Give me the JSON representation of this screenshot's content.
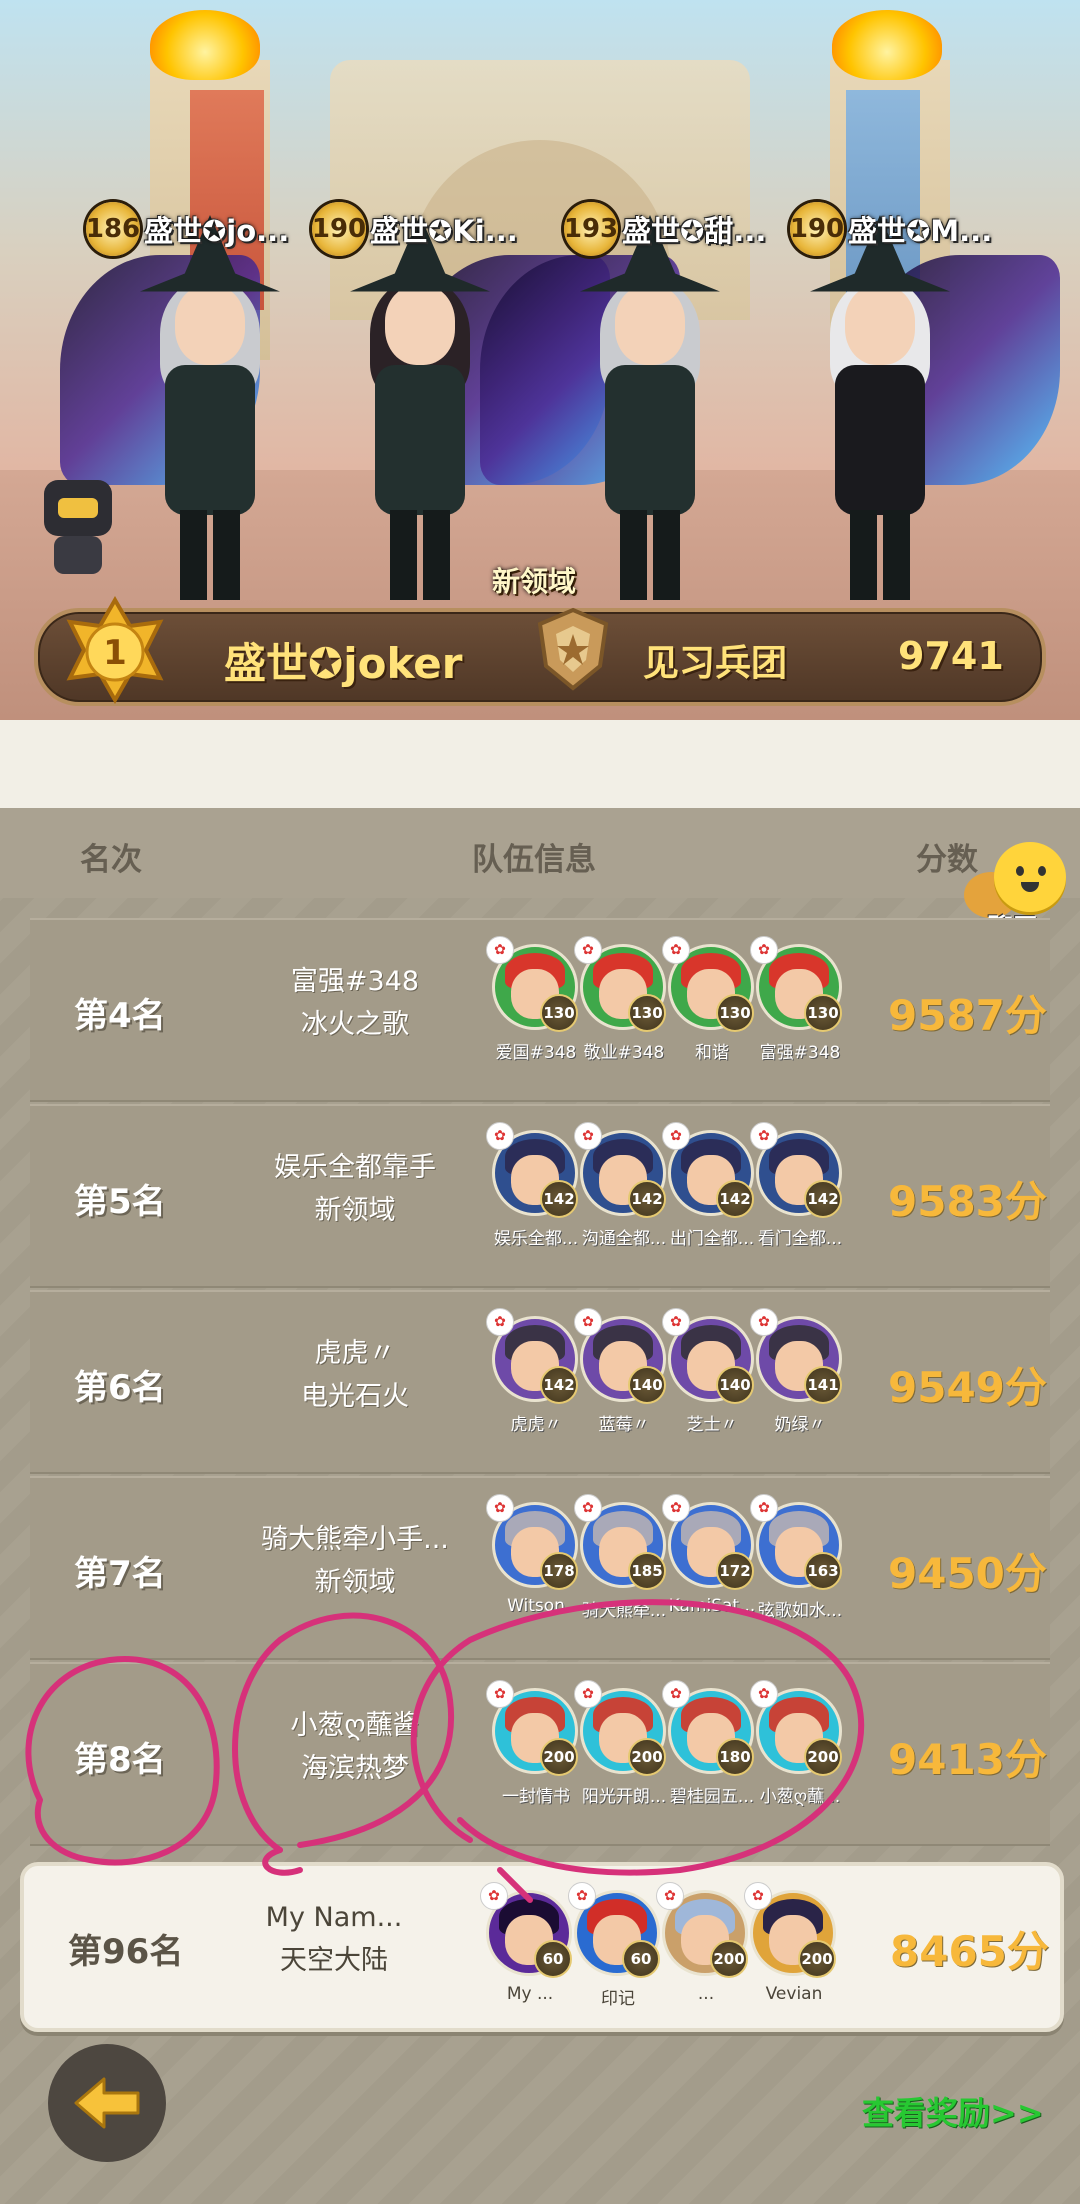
{
  "banner": {
    "players": [
      {
        "level": "186",
        "name": "盛世✪jo..."
      },
      {
        "level": "190",
        "name": "盛世✪Ki..."
      },
      {
        "level": "193",
        "name": "盛世✪甜..."
      },
      {
        "level": "190",
        "name": "盛世✪M..."
      }
    ],
    "territory_label": "新领域",
    "champion": {
      "rank": "1",
      "name": "盛世✪joker",
      "guild": "见习兵团",
      "score": "9741"
    }
  },
  "table_header": {
    "rank": "名次",
    "team": "队伍信息",
    "score": "分数"
  },
  "chat": {
    "label": "聊天"
  },
  "rows": [
    {
      "rank": "第4名",
      "line1": "富强#348",
      "line2": "冰火之歌",
      "score": "9587分",
      "members": [
        {
          "nick": "爱国#348",
          "level": "130"
        },
        {
          "nick": "敬业#348",
          "level": "130"
        },
        {
          "nick": "和谐",
          "level": "130"
        },
        {
          "nick": "富强#348",
          "level": "130"
        }
      ]
    },
    {
      "rank": "第5名",
      "line1": "娱乐全都靠手",
      "line2": "新领域",
      "score": "9583分",
      "members": [
        {
          "nick": "娱乐全都...",
          "level": "142"
        },
        {
          "nick": "沟通全都...",
          "level": "142"
        },
        {
          "nick": "出门全都...",
          "level": "142"
        },
        {
          "nick": "看门全都...",
          "level": "142"
        }
      ]
    },
    {
      "rank": "第6名",
      "line1": "虎虎〃",
      "line2": "电光石火",
      "score": "9549分",
      "members": [
        {
          "nick": "虎虎〃",
          "level": "142"
        },
        {
          "nick": "蓝莓〃",
          "level": "140"
        },
        {
          "nick": "芝士〃",
          "level": "140"
        },
        {
          "nick": "奶绿〃",
          "level": "141"
        }
      ]
    },
    {
      "rank": "第7名",
      "line1": "骑大熊牵小手...",
      "line2": "新领域",
      "score": "9450分",
      "members": [
        {
          "nick": "Witson",
          "level": "178"
        },
        {
          "nick": "骑大熊牵...",
          "level": "185"
        },
        {
          "nick": "KamiSat...",
          "level": "172"
        },
        {
          "nick": "弦歌如水...",
          "level": "163"
        }
      ]
    },
    {
      "rank": "第8名",
      "line1": "小葱ღ蘸酱",
      "line2": "海滨热梦",
      "score": "9413分",
      "members": [
        {
          "nick": "一封情书",
          "level": "200"
        },
        {
          "nick": "阳光开朗...",
          "level": "200"
        },
        {
          "nick": "碧桂园五...",
          "level": "180"
        },
        {
          "nick": "小葱ღ蘸...",
          "level": "200"
        }
      ]
    }
  ],
  "my_row": {
    "rank": "第96名",
    "line1": "My  Nam...",
    "line2": "天空大陆",
    "score": "8465分",
    "members": [
      {
        "nick": "My  ...",
        "level": "60"
      },
      {
        "nick": "印记",
        "level": "60"
      },
      {
        "nick": "...",
        "level": "200"
      },
      {
        "nick": "Vevian",
        "level": "200"
      }
    ]
  },
  "footer": {
    "reward_link": "查看奖励>>"
  },
  "colors": {
    "score_gold": "#f7b83b",
    "annotation_pink": "#d6317a",
    "link_green": "#27c832"
  }
}
